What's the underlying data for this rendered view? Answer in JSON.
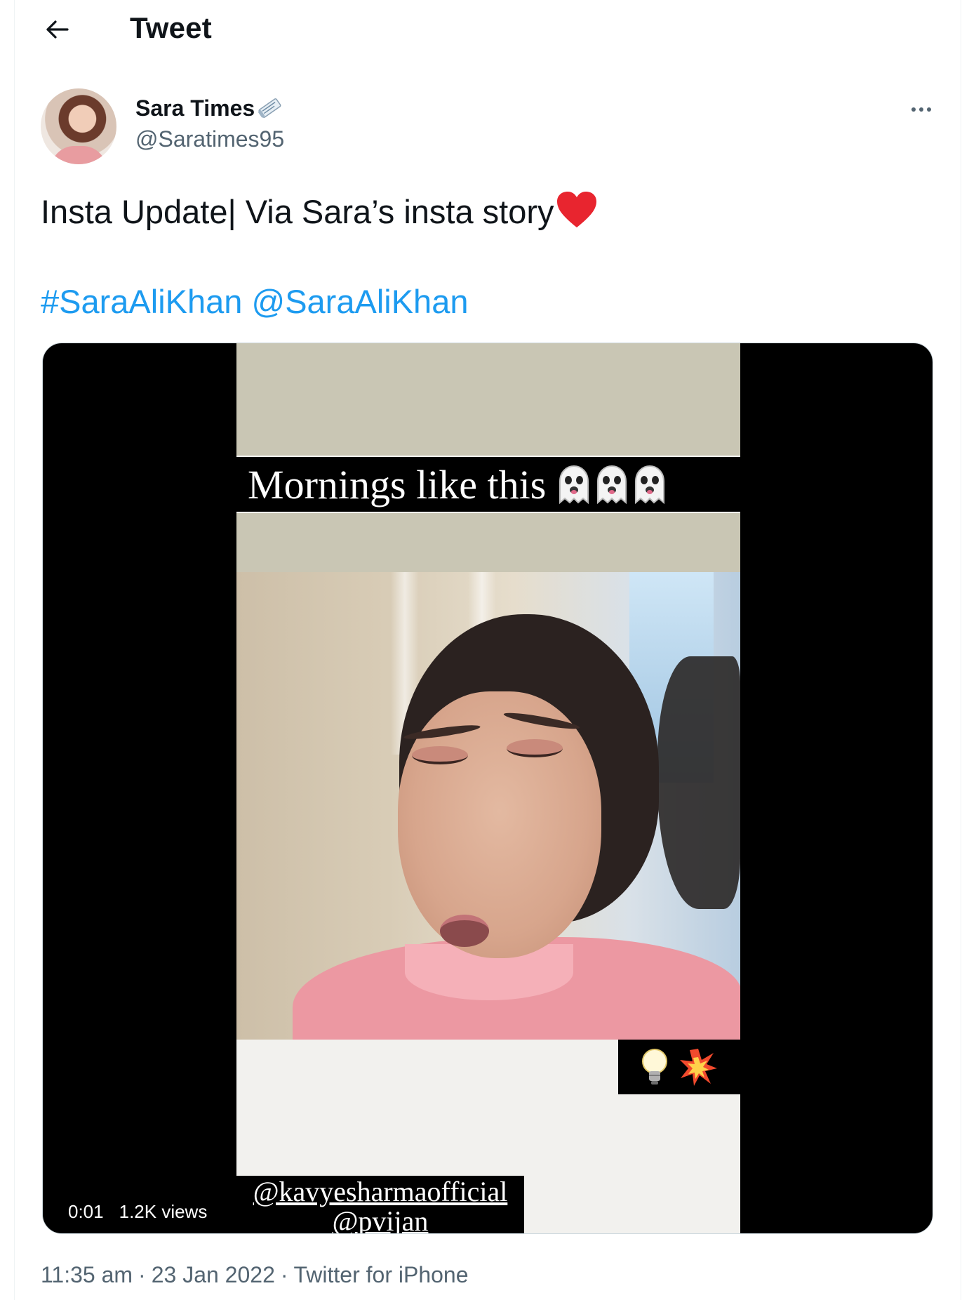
{
  "header": {
    "title": "Tweet",
    "back_icon": "arrow-left-icon"
  },
  "author": {
    "name": "Sara Times",
    "handle": "@Saratimes95",
    "name_emoji_icon": "newspaper-icon"
  },
  "tweet": {
    "text": "Insta Update| Via Sara’s insta story",
    "text_emoji_icon": "red-heart-icon",
    "hashtag": "#SaraAliKhan",
    "mention": "@SaraAliKhan"
  },
  "media": {
    "story_caption": "Mornings like this",
    "caption_emoji_icons": [
      "ghost-icon",
      "ghost-icon",
      "ghost-icon"
    ],
    "corner_emoji_icons": [
      "light-bulb-icon",
      "collision-icon"
    ],
    "tag_line_1": "@kavyesharmaofficial",
    "tag_line_2": "@pvijan",
    "time": "0:01",
    "views": "1.2K views"
  },
  "meta": {
    "time": "11:35 am",
    "separator": "·",
    "date": "23 Jan 2022",
    "source": "Twitter for iPhone"
  },
  "colors": {
    "link": "#1d9bf0",
    "secondary_text": "#536471",
    "primary_text": "#0f1419",
    "heart": "#e8252f"
  }
}
